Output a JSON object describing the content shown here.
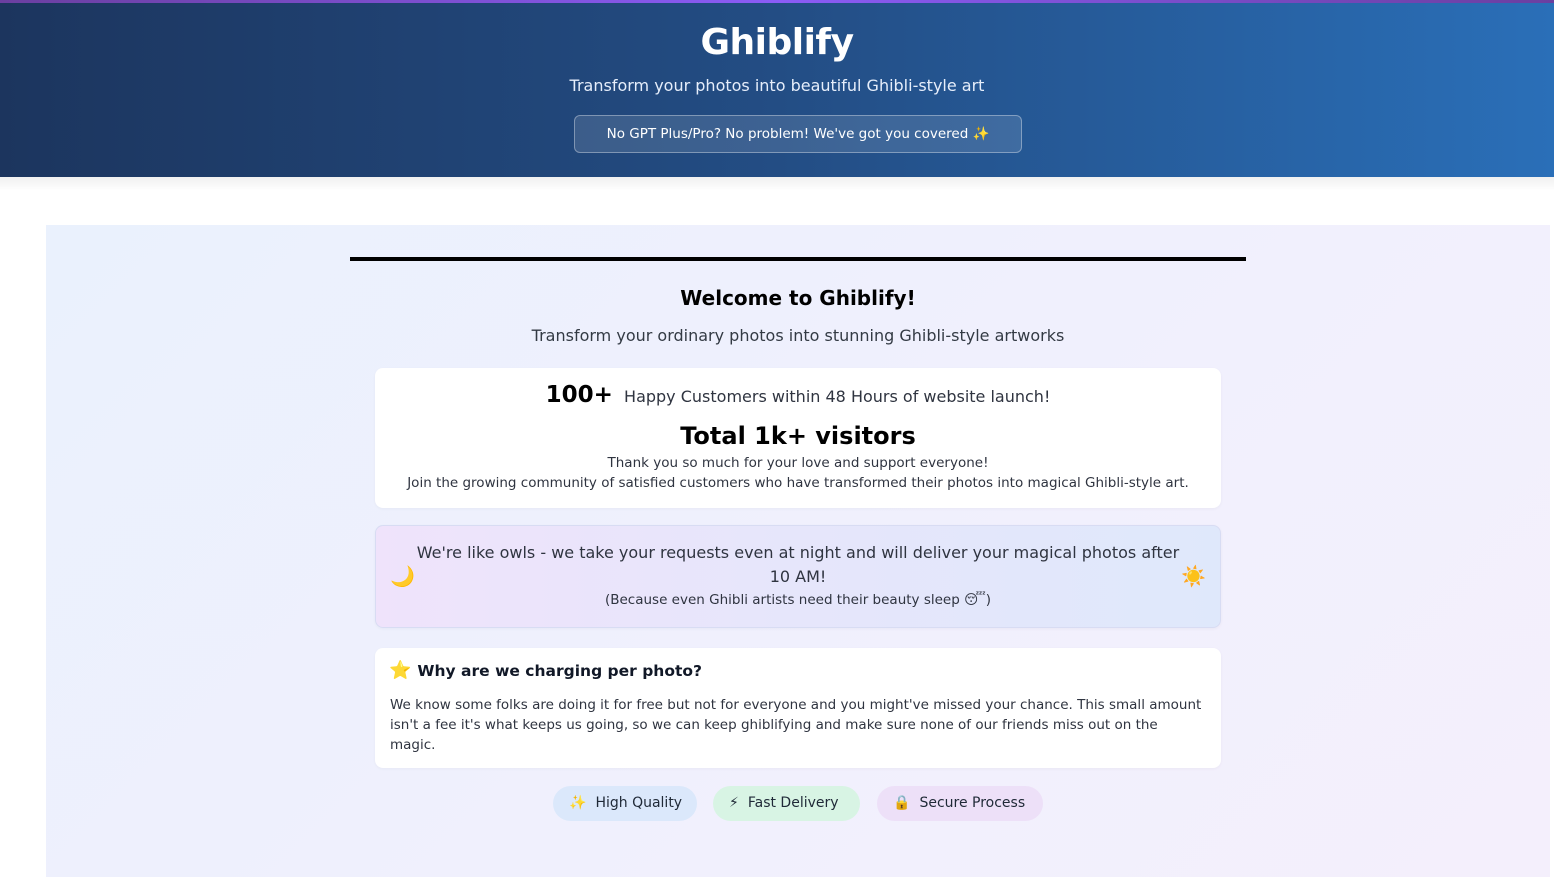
{
  "header": {
    "brand": "Ghiblify",
    "tagline": "Transform your photos into beautiful Ghibli-style art",
    "promo": "No GPT Plus/Pro? No problem! We've got you covered ✨"
  },
  "welcome": {
    "title": "Welcome to Ghiblify!",
    "subtitle": "Transform your ordinary photos into stunning Ghibli-style artworks"
  },
  "stats": {
    "count": "100+",
    "count_text": "Happy Customers within 48 Hours of website launch!",
    "visitors": "Total 1k+ visitors",
    "thanks": "Thank you so much for your love and support everyone!",
    "join": "Join the growing community of satisfied customers who have transformed their photos into magical Ghibli-style art."
  },
  "owl": {
    "moon_icon": "🌙",
    "sun_icon": "☀️",
    "text": "We're like owls - we take your requests even at night and will deliver your magical photos after 10 AM!",
    "sub": "(Because even Ghibli artists need their beauty sleep 😴)"
  },
  "why": {
    "star_icon": "⭐",
    "title": "Why are we charging per photo?",
    "body": "We know some folks are doing it for free but not for everyone and you might've missed your chance. This small amount isn't a fee it's what keeps us going, so we can keep ghiblifying and make sure none of our friends miss out on the magic."
  },
  "features": [
    {
      "icon": "✨",
      "label": "High Quality",
      "color": "#dbe8fb"
    },
    {
      "icon": "⚡",
      "label": "Fast Delivery",
      "color": "#d8f4e4"
    },
    {
      "icon": "🔒",
      "label": "Secure Process",
      "color": "#ede0f8"
    }
  ]
}
